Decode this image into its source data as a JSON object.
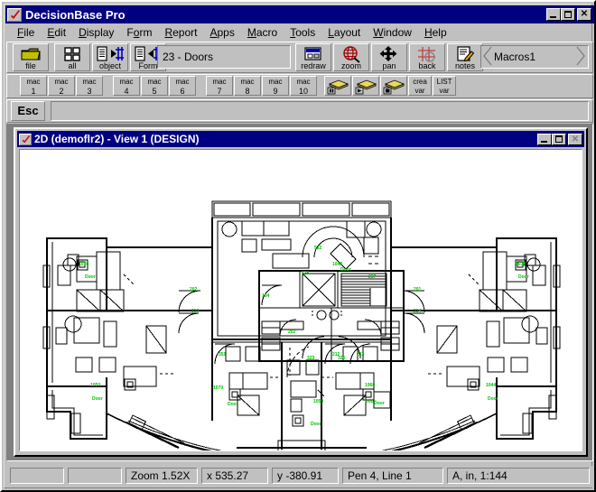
{
  "app": {
    "title": "DecisionBase Pro",
    "icon": "checkmark-icon"
  },
  "window_controls": {
    "minimize": "_",
    "maximize": "❐",
    "close": "✕"
  },
  "menubar": {
    "items": [
      {
        "label": "File",
        "accel": "F"
      },
      {
        "label": "Edit",
        "accel": "E"
      },
      {
        "label": "Display",
        "accel": "D"
      },
      {
        "label": "Form",
        "accel": "o"
      },
      {
        "label": "Report",
        "accel": "R"
      },
      {
        "label": "Apps",
        "accel": "A"
      },
      {
        "label": "Macro",
        "accel": "M"
      },
      {
        "label": "Tools",
        "accel": "T"
      },
      {
        "label": "Layout",
        "accel": "L"
      },
      {
        "label": "Window",
        "accel": "W"
      },
      {
        "label": "Help",
        "accel": "H"
      }
    ]
  },
  "toolbar": {
    "buttons": [
      {
        "label": "file",
        "icon": "folder-icon"
      },
      {
        "label": "all",
        "icon": "grid-four-icon"
      },
      {
        "label": "object",
        "icon": "object-arrow-icon"
      },
      {
        "label": "Form",
        "icon": "form-arrow-icon"
      },
      {
        "label": "redraw",
        "icon": "redraw-icon"
      },
      {
        "label": "zoom",
        "icon": "zoom-globe-icon"
      },
      {
        "label": "pan",
        "icon": "pan-cross-icon"
      },
      {
        "label": "back",
        "icon": "back-grid-icon"
      },
      {
        "label": "notes",
        "icon": "notes-pencil-icon"
      }
    ],
    "object_field": {
      "value": "23 - Doors"
    },
    "macro_selector": {
      "value": "Macros1",
      "prev_arrow": "left-arrow-icon",
      "next_arrow": "right-arrow-icon"
    }
  },
  "macro_bar": {
    "buttons": [
      {
        "line1": "mac",
        "line2": "1"
      },
      {
        "line1": "mac",
        "line2": "2"
      },
      {
        "line1": "mac",
        "line2": "3"
      },
      {
        "line1": "mac",
        "line2": "4"
      },
      {
        "line1": "mac",
        "line2": "5"
      },
      {
        "line1": "mac",
        "line2": "6"
      },
      {
        "line1": "mac",
        "line2": "7"
      },
      {
        "line1": "mac",
        "line2": "8"
      },
      {
        "line1": "mac",
        "line2": "9"
      },
      {
        "line1": "mac",
        "line2": "10"
      }
    ],
    "stack_buttons": [
      {
        "name": "macro-pause",
        "glyph": "pause-icon"
      },
      {
        "name": "macro-play",
        "glyph": "play-icon"
      },
      {
        "name": "macro-stop",
        "glyph": "stop-icon"
      }
    ],
    "var_buttons": [
      {
        "line1": "crea",
        "line2": "var"
      },
      {
        "line1": "LIST",
        "line2": "var"
      }
    ]
  },
  "command_bar": {
    "esc_label": "Esc",
    "input_value": "",
    "input_placeholder": ""
  },
  "document_window": {
    "title": "2D (demoflr2) - View 1 (DESIGN)",
    "icon": "checkmark-icon",
    "controls": {
      "minimize": "_",
      "maximize": "❐",
      "close": "✕"
    }
  },
  "drawing": {
    "description": "architectural-floor-plan",
    "annotation_color": "#00c000",
    "line_color": "#000000",
    "background": "#ffffff",
    "labels": [
      "522",
      "1042",
      "Door",
      "528",
      "287",
      "104",
      "202",
      "510",
      "201",
      "214",
      "323",
      "326",
      "1076",
      "Door",
      "1070",
      "Door",
      "351",
      "1050",
      "Door",
      "212",
      "213",
      "1068",
      "Door",
      "Door",
      "1044",
      "Door",
      "1032",
      "1047"
    ]
  },
  "statusbar": {
    "panes": [
      {
        "name": "status-pane-1",
        "value": ""
      },
      {
        "name": "status-pane-2",
        "value": ""
      },
      {
        "name": "zoom-pane",
        "value": "Zoom 1.52X"
      },
      {
        "name": "x-coord-pane",
        "value": "x 535.27"
      },
      {
        "name": "y-coord-pane",
        "value": "y -380.91"
      },
      {
        "name": "pen-pane",
        "value": "Pen 4,  Line 1"
      },
      {
        "name": "units-pane",
        "value": "A, in, 1:144"
      }
    ]
  }
}
